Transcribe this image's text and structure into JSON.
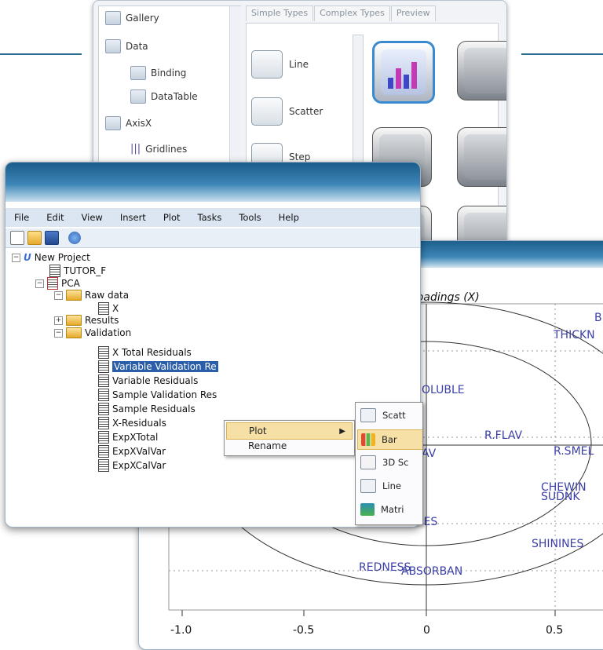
{
  "colors": {
    "accent": "#2c6b93",
    "title_bar": "#2a6e9d",
    "selection": "#2a5ea8",
    "menu_highlight": "#f6e0a6",
    "plot_text": "#3b3fa8"
  },
  "gallery_panel": {
    "tree_items": [
      "Gallery",
      "Data",
      "Binding",
      "DataTable",
      "AxisX",
      "Gridlines"
    ],
    "tabs": [
      "Simple Types",
      "Complex Types",
      "Preview"
    ],
    "chart_types": [
      "Line",
      "Scatter",
      "Step"
    ]
  },
  "main_window": {
    "menu": [
      "File",
      "Edit",
      "View",
      "Insert",
      "Plot",
      "Tasks",
      "Tools",
      "Help"
    ],
    "toolbar_icons": [
      "new-icon",
      "open-icon",
      "save-icon",
      "help-icon"
    ],
    "tree": {
      "project": "New Project",
      "tutor": "TUTOR_F",
      "pca": "PCA",
      "raw_data": "Raw data",
      "x": "X",
      "results": "Results",
      "validation": "Validation",
      "items": [
        "X Total Residuals",
        "Variable Validation Re",
        "Variable Residuals",
        "Sample Validation Res",
        "Sample Residuals",
        "X-Residuals",
        "ExpXTotal",
        "ExpXValVar",
        "ExpXCalVar"
      ]
    }
  },
  "context_menu": {
    "items": [
      "Plot",
      "Rename"
    ]
  },
  "submenu": {
    "items": [
      "Scatt",
      "Bar",
      "3D Sc",
      "Line",
      "Matri"
    ]
  },
  "plot": {
    "title": "Loadings (X)",
    "points": [
      "B",
      "THICKN",
      "OLUBLE",
      "R.FLAV",
      "AV",
      "R.SMEL",
      "CHEWIN",
      "SUDNK",
      "NES",
      "SHININES",
      "REDNESS",
      "ABSORBAN"
    ],
    "x_ticks": [
      "-1.0",
      "-0.5",
      "0",
      "0.5"
    ]
  }
}
